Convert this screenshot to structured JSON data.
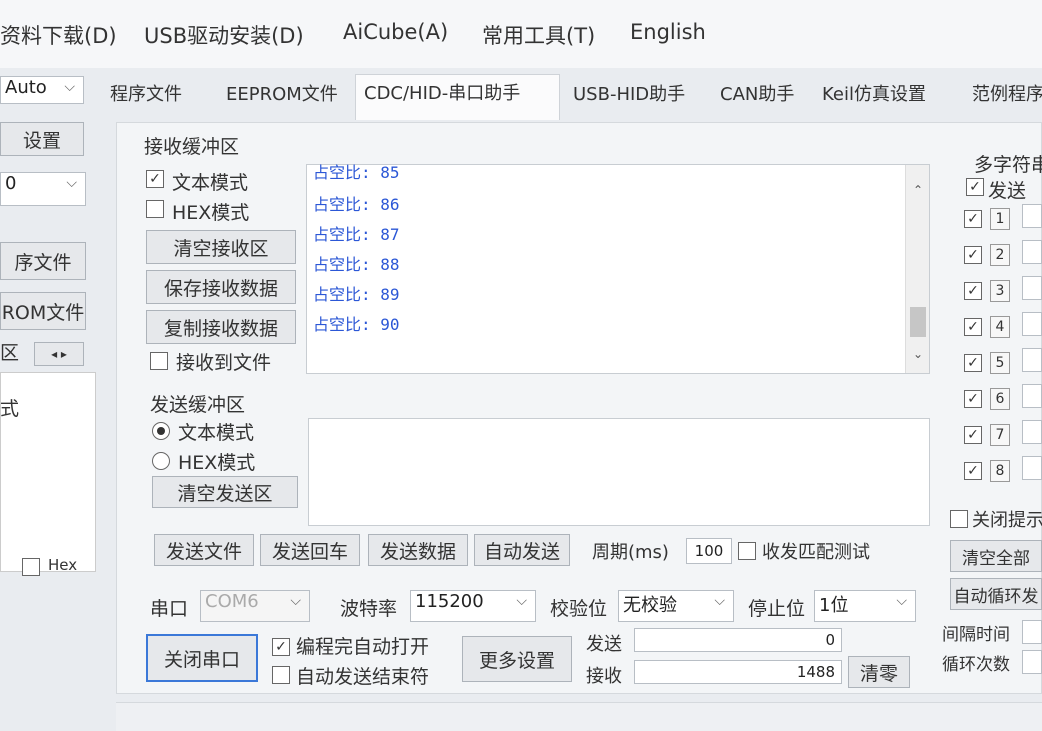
{
  "menubar": {
    "items": [
      "资料下载(D)",
      "USB驱动安装(D)",
      "AiCube(A)",
      "常用工具(T)",
      "English"
    ]
  },
  "tabs": [
    "程序文件",
    "EEPROM文件",
    "CDC/HID-串口助手",
    "USB-HID助手",
    "CAN助手",
    "Keil仿真设置",
    "范例程序"
  ],
  "left": {
    "auto_label": "Auto",
    "settings_button": "设置",
    "value_select": "0",
    "program_file": "序文件",
    "eeprom_file": "ROM文件",
    "zone": "区",
    "style_label": "式",
    "hex_label": "Hex"
  },
  "receive": {
    "title": "接收缓冲区",
    "text_mode": "文本模式",
    "hex_mode": "HEX模式",
    "clear_button": "清空接收区",
    "save_button": "保存接收数据",
    "copy_button": "复制接收数据",
    "receive_file": "接收到文件",
    "lines": [
      "占空比: 85",
      "占空比: 86",
      "占空比: 87",
      "占空比: 88",
      "占空比: 89",
      "占空比: 90"
    ]
  },
  "send": {
    "title": "发送缓冲区",
    "text_mode": "文本模式",
    "hex_mode": "HEX模式",
    "clear_button": "清空发送区",
    "send_file": "发送文件",
    "send_enter": "发送回车",
    "send_data": "发送数据",
    "auto_send": "自动发送",
    "period_label": "周期(ms)",
    "period_value": "100",
    "match_test": "收发匹配测试"
  },
  "serial": {
    "port_label": "串口",
    "port_value": "COM6",
    "baud_label": "波特率",
    "baud_value": "115200",
    "parity_label": "校验位",
    "parity_value": "无校验",
    "stop_label": "停止位",
    "stop_value": "1位",
    "close_button": "关闭串口",
    "auto_open": "编程完自动打开",
    "auto_end": "自动发送结束符",
    "more_settings": "更多设置",
    "send_label": "发送",
    "send_count": "0",
    "receive_label": "接收",
    "receive_count": "1488",
    "clear_count": "清零"
  },
  "multi": {
    "title": "多字符串",
    "send_label": "发送",
    "numbers": [
      "1",
      "2",
      "3",
      "4",
      "5",
      "6",
      "7",
      "8"
    ],
    "close_tip": "关闭提示",
    "clear_all": "清空全部",
    "auto_loop": "自动循环发",
    "interval": "间隔时间",
    "loop_count": "循环次数"
  }
}
